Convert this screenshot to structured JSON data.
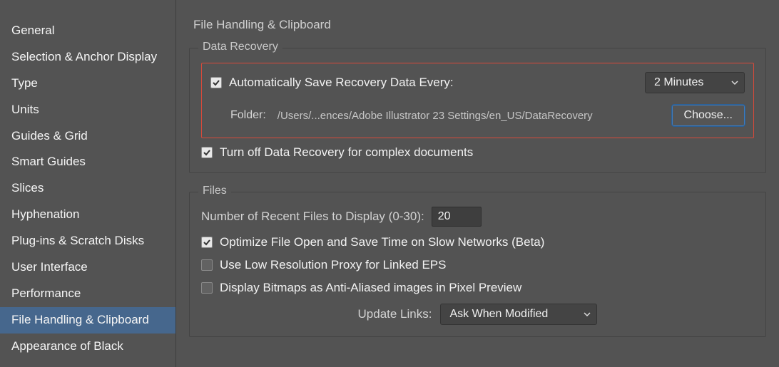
{
  "sidebar": {
    "items": [
      {
        "label": "General"
      },
      {
        "label": "Selection & Anchor Display"
      },
      {
        "label": "Type"
      },
      {
        "label": "Units"
      },
      {
        "label": "Guides & Grid"
      },
      {
        "label": "Smart Guides"
      },
      {
        "label": "Slices"
      },
      {
        "label": "Hyphenation"
      },
      {
        "label": "Plug-ins & Scratch Disks"
      },
      {
        "label": "User Interface"
      },
      {
        "label": "Performance"
      },
      {
        "label": "File Handling & Clipboard"
      },
      {
        "label": "Appearance of Black"
      }
    ],
    "active_index": 11
  },
  "page": {
    "title": "File Handling & Clipboard"
  },
  "data_recovery": {
    "legend": "Data Recovery",
    "auto_save_label": "Automatically Save Recovery Data Every:",
    "interval_value": "2 Minutes",
    "folder_label": "Folder:",
    "folder_path": "/Users/...ences/Adobe Illustrator 23 Settings/en_US/DataRecovery",
    "choose_label": "Choose...",
    "turn_off_label": "Turn off Data Recovery for complex documents"
  },
  "files": {
    "legend": "Files",
    "recent_label": "Number of Recent Files to Display (0-30):",
    "recent_value": "20",
    "optimize_label": "Optimize File Open and Save Time on Slow Networks (Beta)",
    "low_res_label": "Use Low Resolution Proxy for Linked EPS",
    "bitmaps_label": "Display Bitmaps as Anti-Aliased images in Pixel Preview",
    "update_links_label": "Update Links:",
    "update_links_value": "Ask When Modified"
  }
}
